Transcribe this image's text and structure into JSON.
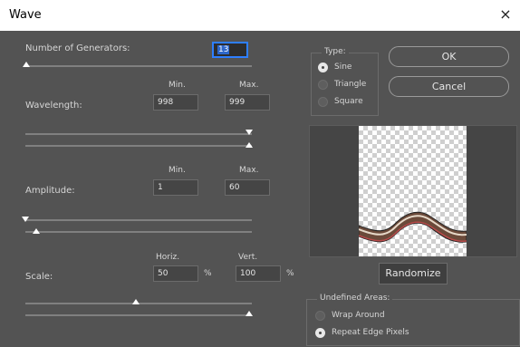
{
  "window": {
    "title": "Wave",
    "close_glyph": "×"
  },
  "generators": {
    "label": "Number of Generators:",
    "value": "13",
    "slider_value": 13
  },
  "wavelength": {
    "label": "Wavelength:",
    "min_header": "Min.",
    "max_header": "Max.",
    "min": "998",
    "max": "999"
  },
  "amplitude": {
    "label": "Amplitude:",
    "min_header": "Min.",
    "max_header": "Max.",
    "min": "1",
    "max": "60"
  },
  "scale": {
    "label": "Scale:",
    "horiz_header": "Horiz.",
    "vert_header": "Vert.",
    "horiz": "50",
    "vert": "100",
    "unit": "%"
  },
  "type": {
    "title": "Type:",
    "options": [
      {
        "label": "Sine",
        "selected": true
      },
      {
        "label": "Triangle",
        "selected": false
      },
      {
        "label": "Square",
        "selected": false
      }
    ]
  },
  "buttons": {
    "ok": "OK",
    "cancel": "Cancel",
    "randomize": "Randomize"
  },
  "undefined_areas": {
    "title": "Undefined Areas:",
    "options": [
      {
        "label": "Wrap Around",
        "selected": false
      },
      {
        "label": "Repeat Edge Pixels",
        "selected": true
      }
    ]
  },
  "icons": {
    "close": "close-icon"
  }
}
